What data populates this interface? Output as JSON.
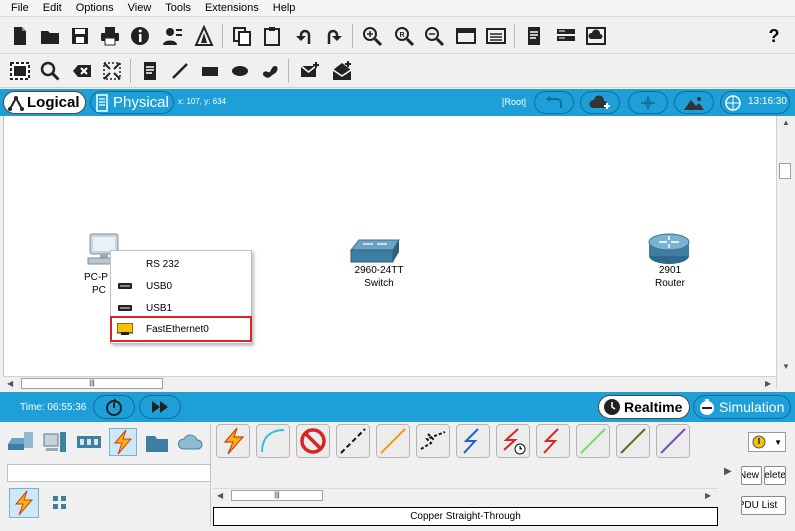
{
  "menu": [
    "File",
    "Edit",
    "Options",
    "View",
    "Tools",
    "Extensions",
    "Help"
  ],
  "workspace": {
    "logical_label": "Logical",
    "physical_label": "Physical",
    "cursor_coords": "x: 107, y: 634",
    "root_label": "[Root]",
    "clock": "13:16:30"
  },
  "devices": [
    {
      "name": "PC-PT",
      "label": "PC-P",
      "sublabel": "PC"
    },
    {
      "name": "2960-24TT",
      "label": "2960-24TT",
      "sublabel": "Switch"
    },
    {
      "name": "2901",
      "label": "2901",
      "sublabel": "Router"
    }
  ],
  "context_menu": {
    "items": [
      {
        "label": "RS 232",
        "icon": "none"
      },
      {
        "label": "USB0",
        "icon": "usb-port-icon"
      },
      {
        "label": "USB1",
        "icon": "usb-port-icon"
      },
      {
        "label": "FastEthernet0",
        "icon": "ethernet-port-icon",
        "highlighted": true
      }
    ]
  },
  "simbar": {
    "time": "Time: 06:55:36",
    "realtime_label": "Realtime",
    "simulation_label": "Simulation"
  },
  "connections": {
    "status": "Copper Straight-Through"
  },
  "right_panel": {
    "btn_new": "New",
    "btn_delete": "Delete",
    "btn_pdu": "PDU List"
  },
  "help_label": "?",
  "colors": {
    "accent_blue": "#1e9fd8",
    "highlight_red": "#d82424",
    "lightning": "#f4b400"
  }
}
